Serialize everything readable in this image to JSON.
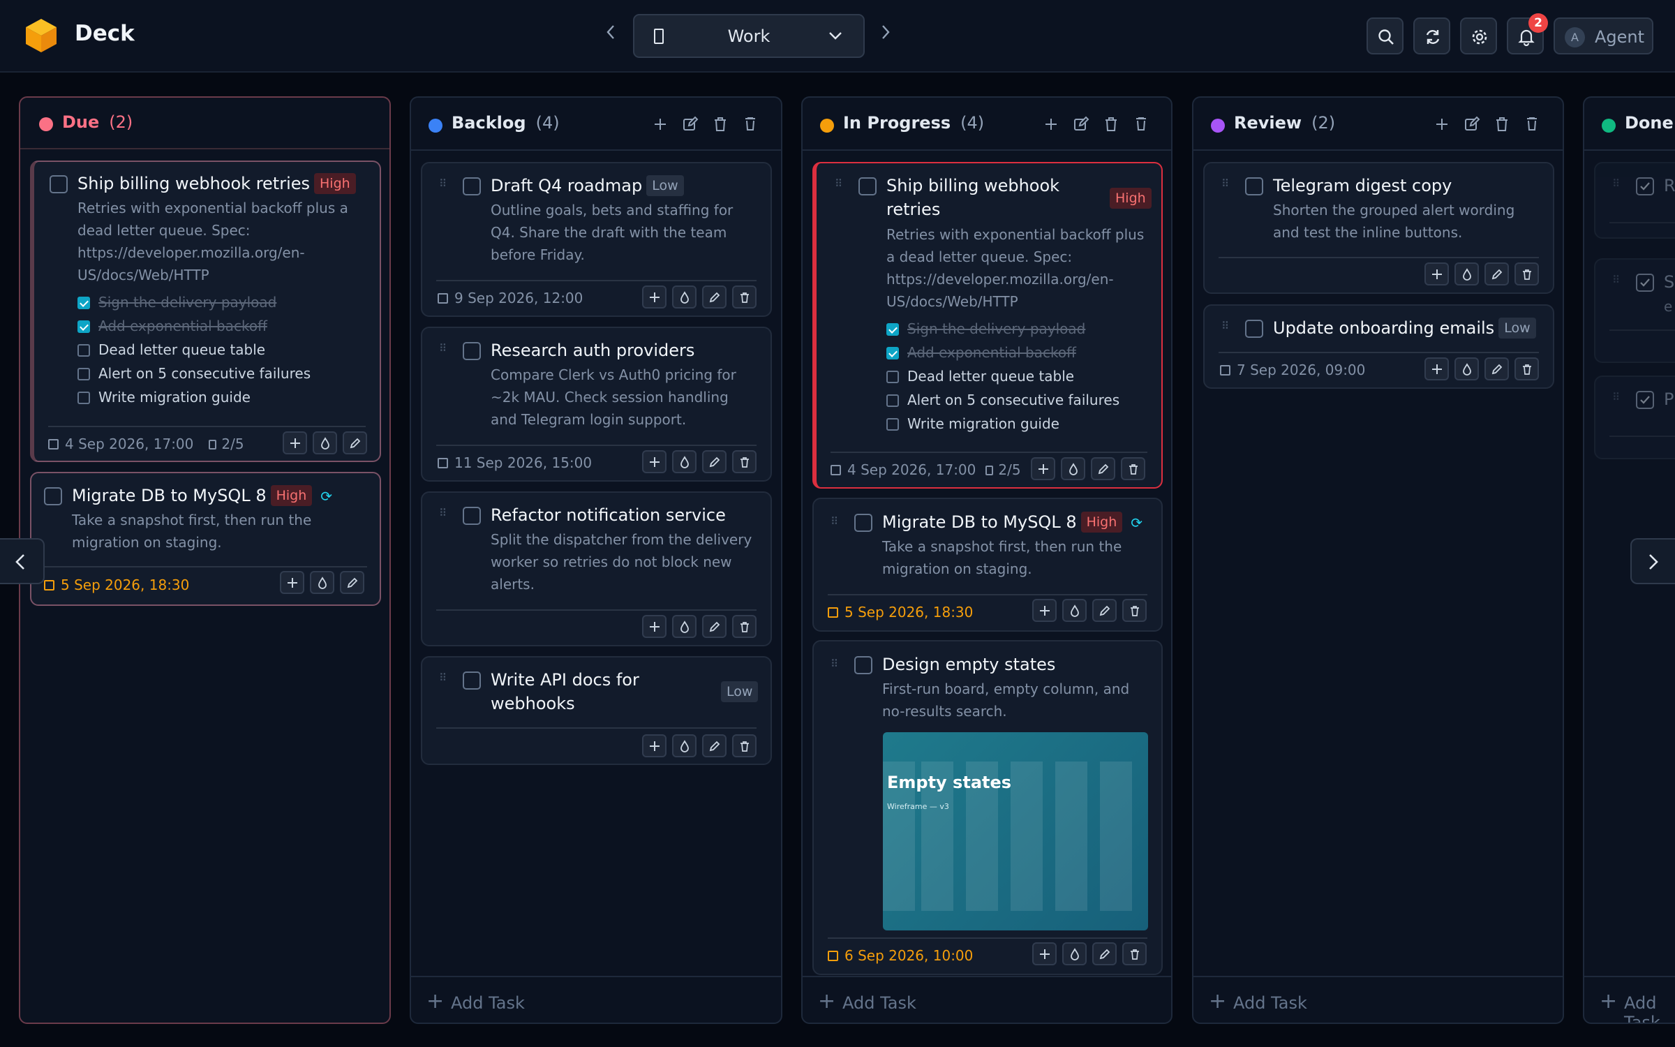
{
  "app": {
    "name": "Deck",
    "board": "Work",
    "notification_count": "2",
    "user_initial": "A",
    "user_name": "Agent"
  },
  "icons": [
    "logo-cube-icon",
    "chevron-left-icon",
    "chevron-right-icon",
    "board-icon",
    "chevron-down-icon",
    "search-icon",
    "refresh-icon",
    "gear-icon",
    "bell-icon",
    "plus-icon",
    "edit-icon",
    "trash-icon",
    "archive-icon",
    "calendar-icon",
    "clipboard-icon",
    "drop-icon",
    "pencil-icon",
    "drag-handle-icon",
    "recurring-icon"
  ],
  "colors": {
    "due": "#fb7185",
    "backlog": "#3b82f6",
    "in_progress": "#f59e0b",
    "review": "#a855f7",
    "done": "#10b981",
    "high": "#f87171",
    "overdue": "#f59e0b",
    "accent": "#0ea5c6"
  },
  "footer": {
    "add_task": "Add Task"
  },
  "columns": {
    "due": {
      "title": "Due",
      "count": "(2)",
      "cards": [
        {
          "title": "Ship billing webhook retries",
          "priority": "High",
          "desc": [
            "Retries with exponential backoff plus a",
            "dead letter queue. Spec:",
            "https://developer.mozilla.org/en-",
            "US/docs/Web/HTTP"
          ],
          "subtasks": [
            {
              "text": "Sign the delivery payload",
              "done": true
            },
            {
              "text": "Add exponential backoff",
              "done": true
            },
            {
              "text": "Dead letter queue table",
              "done": false
            },
            {
              "text": "Alert on 5 consecutive failures",
              "done": false
            },
            {
              "text": "Write migration guide",
              "done": false
            }
          ],
          "due": "4 Sep 2026, 17:00",
          "progress": "2/5"
        },
        {
          "title": "Migrate DB to MySQL 8",
          "priority": "High",
          "desc": [
            "Take a snapshot first, then run the",
            "migration on staging."
          ],
          "due": "5 Sep 2026, 18:30"
        }
      ]
    },
    "backlog": {
      "title": "Backlog",
      "count": "(4)",
      "cards": [
        {
          "title": "Draft Q4 roadmap",
          "priority": "Low",
          "desc": [
            "Outline goals, bets and staffing for",
            "Q4. Share the draft with the team",
            "before Friday."
          ],
          "due": "9 Sep 2026, 12:00"
        },
        {
          "title": "Research auth providers",
          "desc": [
            "Compare Clerk vs Auth0 pricing for",
            "~2k MAU. Check session handling",
            "and Telegram login support."
          ],
          "due": "11 Sep 2026, 15:00"
        },
        {
          "title": "Refactor notification service",
          "desc": [
            "Split the dispatcher from the delivery",
            "worker so retries do not block new",
            "alerts."
          ]
        },
        {
          "title_lines": [
            "Write API docs for",
            "webhooks"
          ],
          "priority": "Low"
        }
      ]
    },
    "in_progress": {
      "title": "In Progress",
      "count": "(4)",
      "cards": [
        {
          "title_lines": [
            "Ship billing webhook",
            "retries"
          ],
          "priority": "High",
          "desc": [
            "Retries with exponential backoff plus",
            "a dead letter queue. Spec:",
            "https://developer.mozilla.org/en-",
            "US/docs/Web/HTTP"
          ],
          "subtasks": [
            {
              "text": "Sign the delivery payload",
              "done": true
            },
            {
              "text": "Add exponential backoff",
              "done": true
            },
            {
              "text": "Dead letter queue table",
              "done": false
            },
            {
              "text": "Alert on 5 consecutive failures",
              "done": false
            },
            {
              "text": "Write migration guide",
              "done": false
            }
          ],
          "due": "4 Sep 2026, 17:00",
          "progress": "2/5"
        },
        {
          "title": "Migrate DB to MySQL 8",
          "priority": "High",
          "desc": [
            "Take a snapshot first, then run the",
            "migration on staging."
          ],
          "due": "5 Sep 2026, 18:30"
        },
        {
          "title": "Design empty states",
          "desc": [
            "First-run board, empty column, and",
            "no-results search."
          ],
          "image_title": "Empty states",
          "image_sub": "Wireframe — v3",
          "due": "6 Sep 2026, 10:00"
        }
      ]
    },
    "review": {
      "title": "Review",
      "count": "(2)",
      "cards": [
        {
          "title": "Telegram digest copy",
          "desc": [
            "Shorten the grouped alert wording",
            "and test the inline buttons."
          ]
        },
        {
          "title": "Update onboarding emails",
          "priority": "Low",
          "due": "7 Sep 2026, 09:00"
        }
      ]
    },
    "done": {
      "title": "Done",
      "cards": [
        {
          "title_peek": "R"
        },
        {
          "title_peek": "S",
          "desc_peek": "e"
        },
        {
          "title_peek": "P"
        }
      ]
    }
  }
}
